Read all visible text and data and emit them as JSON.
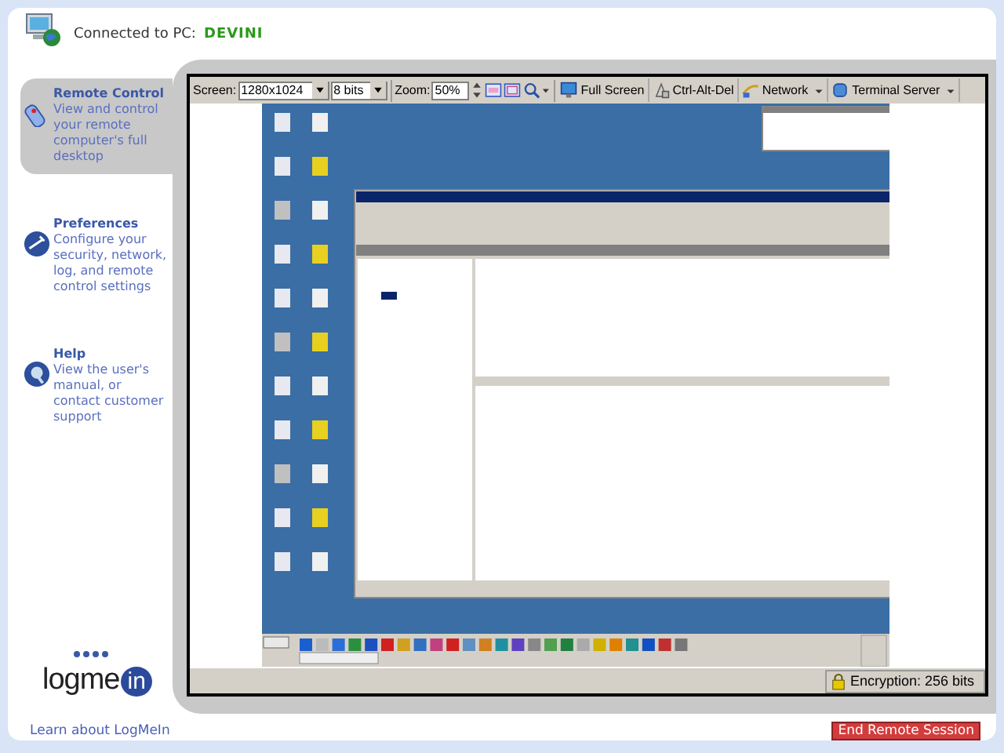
{
  "header": {
    "label": "Connected to PC:",
    "pc_name": "DEVINI"
  },
  "nav": [
    {
      "title": "Remote Control",
      "description": "View and control your remote computer's full desktop",
      "selected": true
    },
    {
      "title": "Preferences",
      "description": "Configure your security, network, log, and remote control settings",
      "selected": false
    },
    {
      "title": "Help",
      "description": "View the user's manual, or contact customer support",
      "selected": false
    }
  ],
  "toolbar": {
    "screen_label": "Screen:",
    "resolution": "1280x1024",
    "color_depth": "8 bits",
    "zoom_label": "Zoom:",
    "zoom": "50%",
    "buttons": [
      {
        "label": "Full Screen",
        "dropdown": false
      },
      {
        "label": "Ctrl-Alt-Del",
        "dropdown": false
      },
      {
        "label": "Network",
        "dropdown": true
      },
      {
        "label": "Terminal Server",
        "dropdown": true
      }
    ]
  },
  "status_bar": {
    "encryption": "Encryption: 256 bits"
  },
  "logo": {
    "text": "logme",
    "badge": "in"
  },
  "footer": {
    "link": "Learn about LogMeIn",
    "end_button": "End Remote Session"
  }
}
